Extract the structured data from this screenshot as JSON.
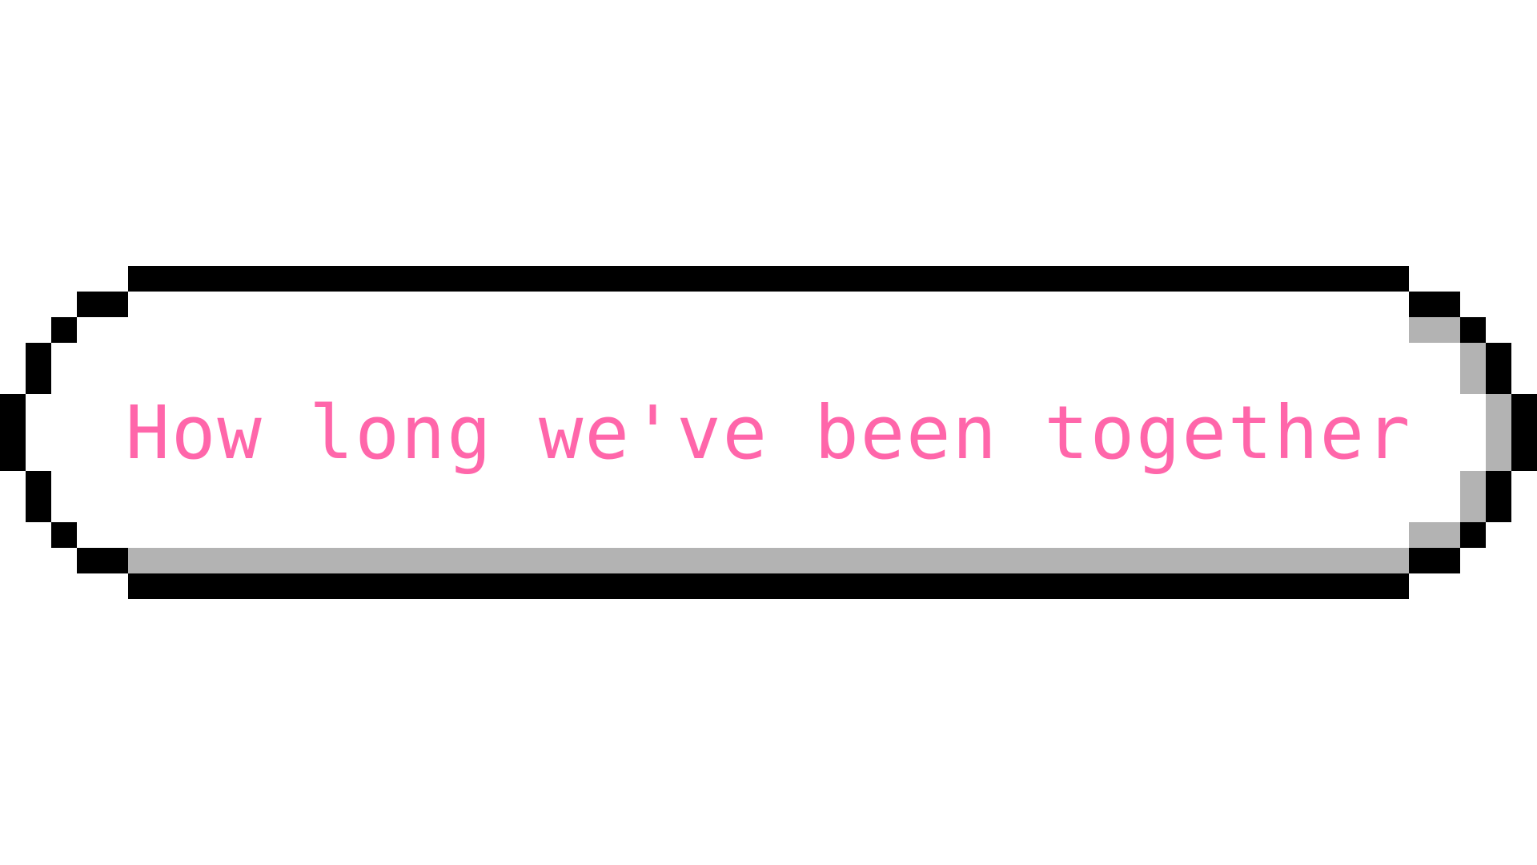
{
  "banner": {
    "text": "How long we've been together",
    "text_color": "#ff66aa",
    "border_color": "#000000",
    "shadow_color": "#b3b3b3",
    "fill_color": "#ffffff"
  }
}
